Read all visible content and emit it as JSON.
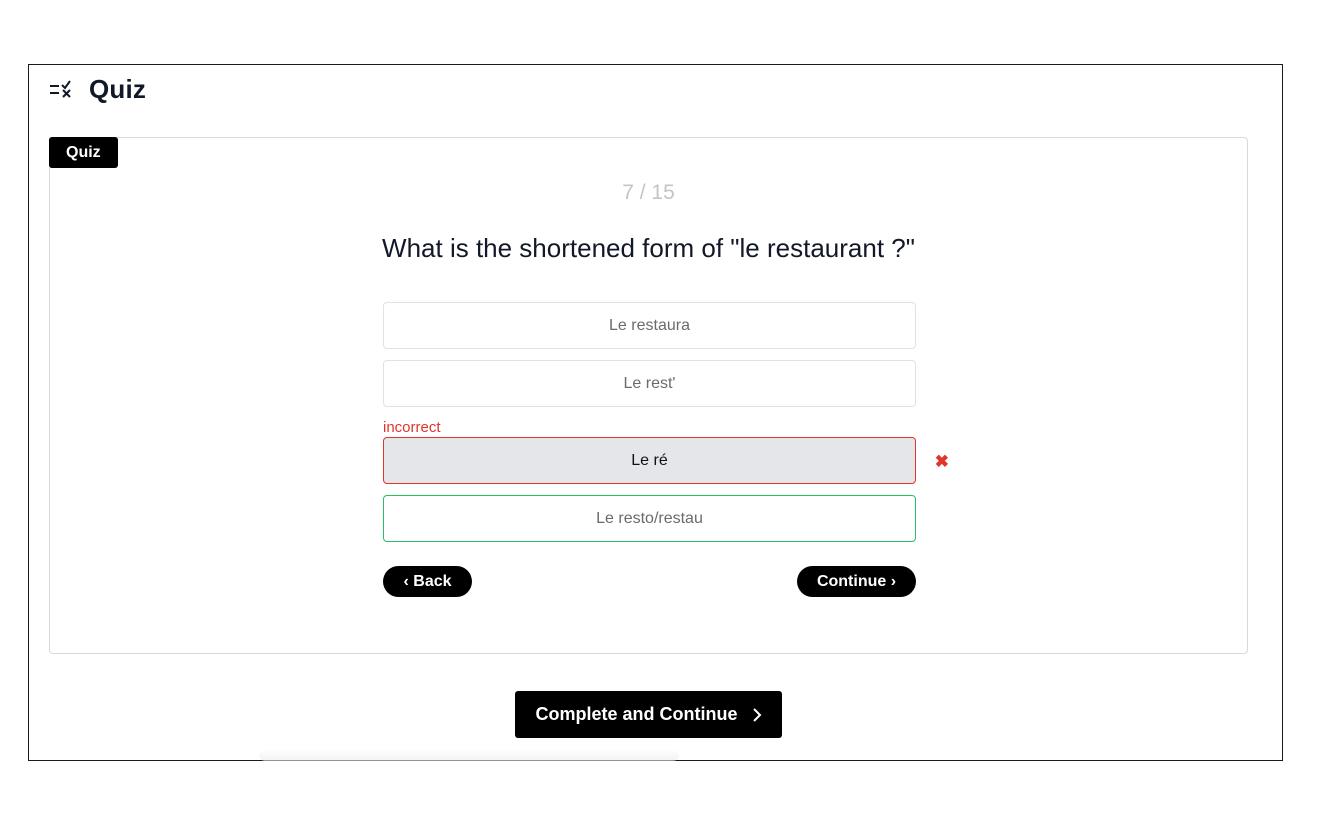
{
  "header": {
    "title": "Quiz",
    "icon": "quiz-list-check-icon"
  },
  "card": {
    "tag": "Quiz",
    "counter": "7 / 15",
    "question": "What is the shortened form of \"le restaurant ?\""
  },
  "options": [
    {
      "label": "Le restaura",
      "state": "default"
    },
    {
      "label": "Le rest'",
      "state": "default"
    },
    {
      "label": "Le ré",
      "state": "incorrect-selected",
      "feedback": "incorrect"
    },
    {
      "label": "Le resto/restau",
      "state": "correct"
    }
  ],
  "nav": {
    "back_label": "‹ Back",
    "continue_label": "Continue ›"
  },
  "footer": {
    "complete_label": "Complete and Continue",
    "complete_icon": "chevron-right-icon"
  },
  "colors": {
    "incorrect": "#e0352b",
    "correct": "#2bbf63",
    "button": "#000000"
  }
}
